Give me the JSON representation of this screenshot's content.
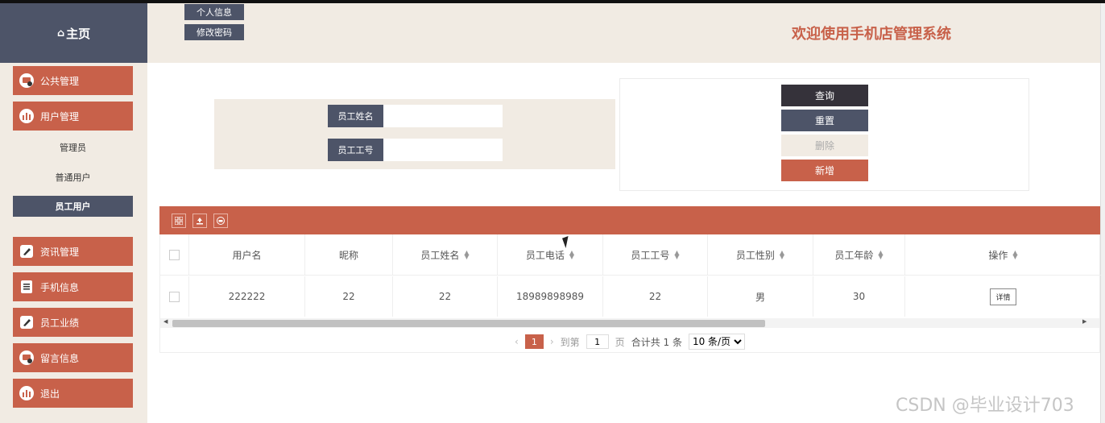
{
  "header": {
    "buttons": [
      "个人信息",
      "修改密码"
    ],
    "title": "欢迎使用手机店管理系统"
  },
  "sidebar": {
    "brand": "主页",
    "brand_icon": "home-icon",
    "menu": [
      {
        "label": "公共管理",
        "icon": "public-icon"
      },
      {
        "label": "用户管理",
        "icon": "chart-icon"
      },
      {
        "label": "资讯管理",
        "icon": "edit-icon"
      },
      {
        "label": "手机信息",
        "icon": "list-icon"
      },
      {
        "label": "员工业绩",
        "icon": "edit-icon"
      },
      {
        "label": "留言信息",
        "icon": "message-icon"
      },
      {
        "label": "退出",
        "icon": "chart-icon"
      }
    ],
    "submenu": [
      "管理员",
      "普通用户",
      "员工用户"
    ],
    "active_submenu": "员工用户"
  },
  "search": {
    "name_label": "员工姓名",
    "name_value": "",
    "id_label": "员工工号",
    "id_value": ""
  },
  "actions": {
    "query": "查询",
    "reset": "重置",
    "delete": "删除",
    "add": "新增"
  },
  "toolbar_icons": [
    "grid-icon",
    "upload-icon",
    "print-icon"
  ],
  "table": {
    "headers": [
      "用户名",
      "昵称",
      "员工姓名",
      "员工电话",
      "员工工号",
      "员工性别",
      "员工年龄",
      "操作"
    ],
    "rows": [
      {
        "username": "222222",
        "nickname": "22",
        "name": "22",
        "phone": "18989898989",
        "id": "22",
        "gender": "男",
        "age": "30",
        "action": "详情"
      }
    ]
  },
  "pagination": {
    "current": "1",
    "goto_label": "到第",
    "goto_value": "1",
    "page_unit": "页",
    "total_text": "合计共 1 条",
    "page_size": "10 条/页"
  },
  "watermark": "CSDN @毕业设计703",
  "colors": {
    "accent": "#c8614a",
    "dark": "#4d5468",
    "beige": "#f1ebe3",
    "query_bg": "#35323a",
    "delete_bg": "#f1ebe3"
  }
}
